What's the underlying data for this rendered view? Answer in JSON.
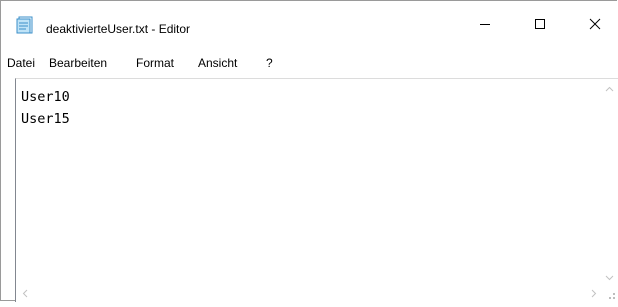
{
  "window": {
    "title": "deaktivierteUser.txt - Editor"
  },
  "menu": {
    "items": [
      {
        "label": "Datei"
      },
      {
        "label": "Bearbeiten"
      },
      {
        "label": "Format"
      },
      {
        "label": "Ansicht"
      },
      {
        "label": "?"
      }
    ]
  },
  "editor": {
    "lines": [
      "User10",
      "User15"
    ]
  },
  "icons": {
    "app": "notepad-icon",
    "minimize": "minimize-icon",
    "maximize": "maximize-icon",
    "close": "close-icon"
  }
}
